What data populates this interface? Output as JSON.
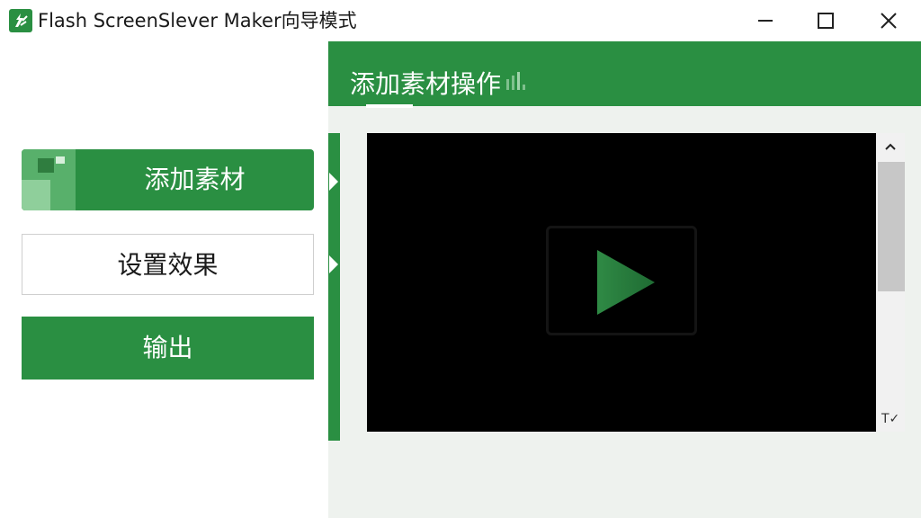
{
  "window": {
    "title": "Flash ScreenSlever Maker向导模式"
  },
  "sidebar": {
    "items": [
      {
        "label": "添加素材",
        "state": "active"
      },
      {
        "label": "设置效果",
        "state": "normal"
      },
      {
        "label": "输出",
        "state": "normal"
      }
    ]
  },
  "main": {
    "tab_title": "添加素材操作",
    "player": {
      "play_icon": "play-icon"
    },
    "scrollbar": {
      "corner_label": "T✓"
    }
  },
  "colors": {
    "brand_green": "#2a8f42",
    "light_green": "#58b06b",
    "video_bg": "#000000",
    "panel_bg": "#eef2ee"
  },
  "icons": [
    "app-logo-icon",
    "minimize-icon",
    "maximize-icon",
    "close-icon",
    "play-icon",
    "scroll-up-icon",
    "signal-bars-icon"
  ]
}
